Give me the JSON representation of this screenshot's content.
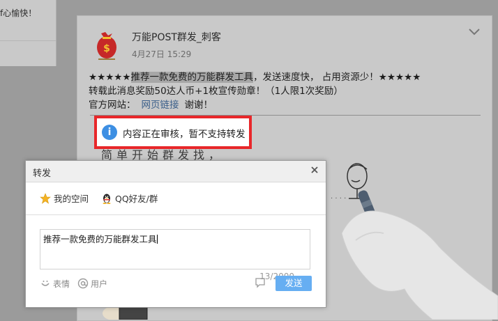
{
  "left_card": {
    "text": "f心愉快！"
  },
  "post": {
    "author": "万能POST群发_刺客",
    "time": "4月27日 15:29",
    "line1_prefix": "★★★★★",
    "line1_highlight": "推荐一款免费的万能群发工具",
    "line1_suffix": "，发送速度快， 占用资源少！★★★★★",
    "line2": "转载此消息奖励50达人币+1枚宣传勋章！（1人限1次奖励）",
    "line3_prefix": "官方网站：",
    "line3_link": "网页链接",
    "line3_suffix": "谢谢！",
    "sketch_text": "简单开始群发找，"
  },
  "notice": {
    "text": "内容正在审核，暂不支持转发",
    "icon": "info-icon"
  },
  "dialog": {
    "title": "转发",
    "tabs": [
      {
        "label": "我的空间",
        "icon": "star-icon",
        "active": true
      },
      {
        "label": "QQ好友/群",
        "icon": "qq-penguin-icon",
        "active": false
      }
    ],
    "textarea_value": "推荐一款免费的万能群发工具",
    "counter": "13/2000",
    "tools": [
      {
        "label": "表情",
        "icon": "smiley-icon"
      },
      {
        "label": "用户",
        "icon": "at-icon"
      }
    ],
    "send_label": "发送"
  },
  "colors": {
    "notice_border": "#e8272a",
    "info_blue": "#3d8fe3",
    "send_button": "#66aef2",
    "tab_underline": "#2a7bd3"
  }
}
